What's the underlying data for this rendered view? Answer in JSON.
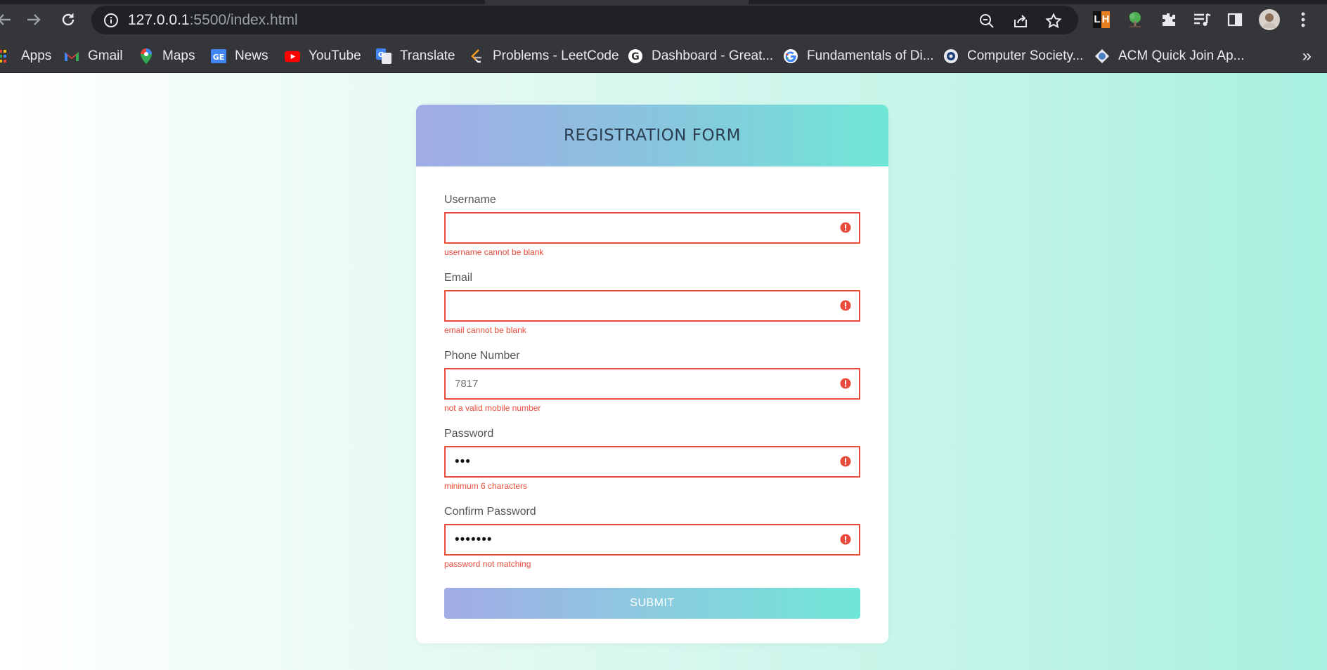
{
  "browser": {
    "url_host": "127.0.0.1",
    "url_rest": ":5500/index.html",
    "bookmarks": [
      {
        "label": "Apps",
        "icon": "apps-grid-icon"
      },
      {
        "label": "Gmail",
        "icon": "gmail-icon"
      },
      {
        "label": "Maps",
        "icon": "maps-pin-icon"
      },
      {
        "label": "News",
        "icon": "news-icon"
      },
      {
        "label": "YouTube",
        "icon": "youtube-icon"
      },
      {
        "label": "Translate",
        "icon": "translate-icon"
      },
      {
        "label": "Problems - LeetCode",
        "icon": "leetcode-icon"
      },
      {
        "label": "Dashboard - Great...",
        "icon": "g-circle-icon"
      },
      {
        "label": "Fundamentals of Di...",
        "icon": "google-icon"
      },
      {
        "label": "Computer Society...",
        "icon": "computer-society-icon"
      },
      {
        "label": "ACM Quick Join Ap...",
        "icon": "acm-icon"
      }
    ],
    "more": "»",
    "extensions": {
      "lighthouse": "LH"
    }
  },
  "form": {
    "title": "REGISTRATION FORM",
    "fields": [
      {
        "label": "Username",
        "value": "",
        "error": "username cannot be blank",
        "type": "text"
      },
      {
        "label": "Email",
        "value": "",
        "error": "email cannot be blank",
        "type": "text"
      },
      {
        "label": "Phone Number",
        "value": "7817",
        "error": "not a valid mobile number",
        "type": "text"
      },
      {
        "label": "Password",
        "value": "•••",
        "error": "minimum 6 characters",
        "type": "password"
      },
      {
        "label": "Confirm Password",
        "value": "•••••••",
        "error": "password not matching",
        "type": "password"
      }
    ],
    "submit_label": "SUBMIT",
    "error_color": "#e74c3c",
    "accent_gradient": [
      "#a1abe6",
      "#70e7d6"
    ]
  }
}
